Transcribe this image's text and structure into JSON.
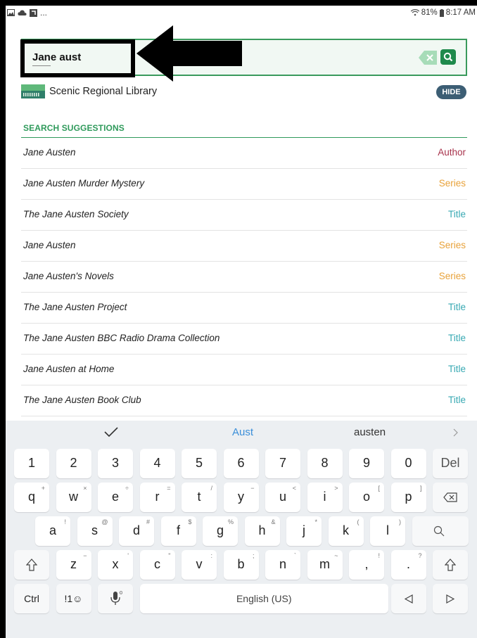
{
  "status_bar": {
    "left_icons": [
      "image-icon",
      "cloud-icon",
      "app-icon"
    ],
    "more": "...",
    "battery": "81%",
    "time": "8:17 AM"
  },
  "search": {
    "value": "Jane aust",
    "clear_icon": "clear-icon",
    "go_icon": "search-icon"
  },
  "library": {
    "name": "Scenic Regional Library",
    "hide_label": "HIDE"
  },
  "suggestions": {
    "header": "SEARCH SUGGESTIONS",
    "items": [
      {
        "title": "Jane Austen",
        "type": "Author"
      },
      {
        "title": "Jane Austen Murder Mystery",
        "type": "Series"
      },
      {
        "title": "The Jane Austen Society",
        "type": "Title"
      },
      {
        "title": "Jane Austen",
        "type": "Series"
      },
      {
        "title": "Jane Austen's Novels",
        "type": "Series"
      },
      {
        "title": "The Jane Austen Project",
        "type": "Title"
      },
      {
        "title": "The Jane Austen BBC Radio Drama Collection",
        "type": "Title"
      },
      {
        "title": "Jane Austen at Home",
        "type": "Title"
      },
      {
        "title": "The Jane Austen Book Club",
        "type": "Title"
      }
    ]
  },
  "colors": {
    "Author": "#a8344d",
    "Series": "#e8a23a",
    "Title": "#38a9b3",
    "accent_green": "#2f9a5b"
  },
  "keyboard": {
    "predictions": [
      "Aust",
      "austen"
    ],
    "number_row": [
      "1",
      "2",
      "3",
      "4",
      "5",
      "6",
      "7",
      "8",
      "9",
      "0",
      "Del"
    ],
    "row1": [
      [
        "q",
        "+"
      ],
      [
        "w",
        "×"
      ],
      [
        "e",
        "÷"
      ],
      [
        "r",
        "="
      ],
      [
        "t",
        "/"
      ],
      [
        "y",
        "−"
      ],
      [
        "u",
        "<"
      ],
      [
        "i",
        ">"
      ],
      [
        "o",
        "["
      ],
      [
        "p",
        "]"
      ]
    ],
    "row2": [
      [
        "a",
        "!"
      ],
      [
        "s",
        "@"
      ],
      [
        "d",
        "#"
      ],
      [
        "f",
        "$"
      ],
      [
        "g",
        "%"
      ],
      [
        "h",
        "&"
      ],
      [
        "j",
        "*"
      ],
      [
        "k",
        "("
      ],
      [
        "l",
        ")"
      ]
    ],
    "row3": [
      [
        "z",
        "−"
      ],
      [
        "x",
        "'"
      ],
      [
        "c",
        "\""
      ],
      [
        "v",
        ":"
      ],
      [
        "b",
        ";"
      ],
      [
        "n",
        "`"
      ],
      [
        "m",
        "~"
      ],
      [
        ",",
        "!"
      ],
      [
        ".",
        "?"
      ]
    ],
    "ctrl": "Ctrl",
    "symbols": "!1☺",
    "space": "English (US)"
  }
}
